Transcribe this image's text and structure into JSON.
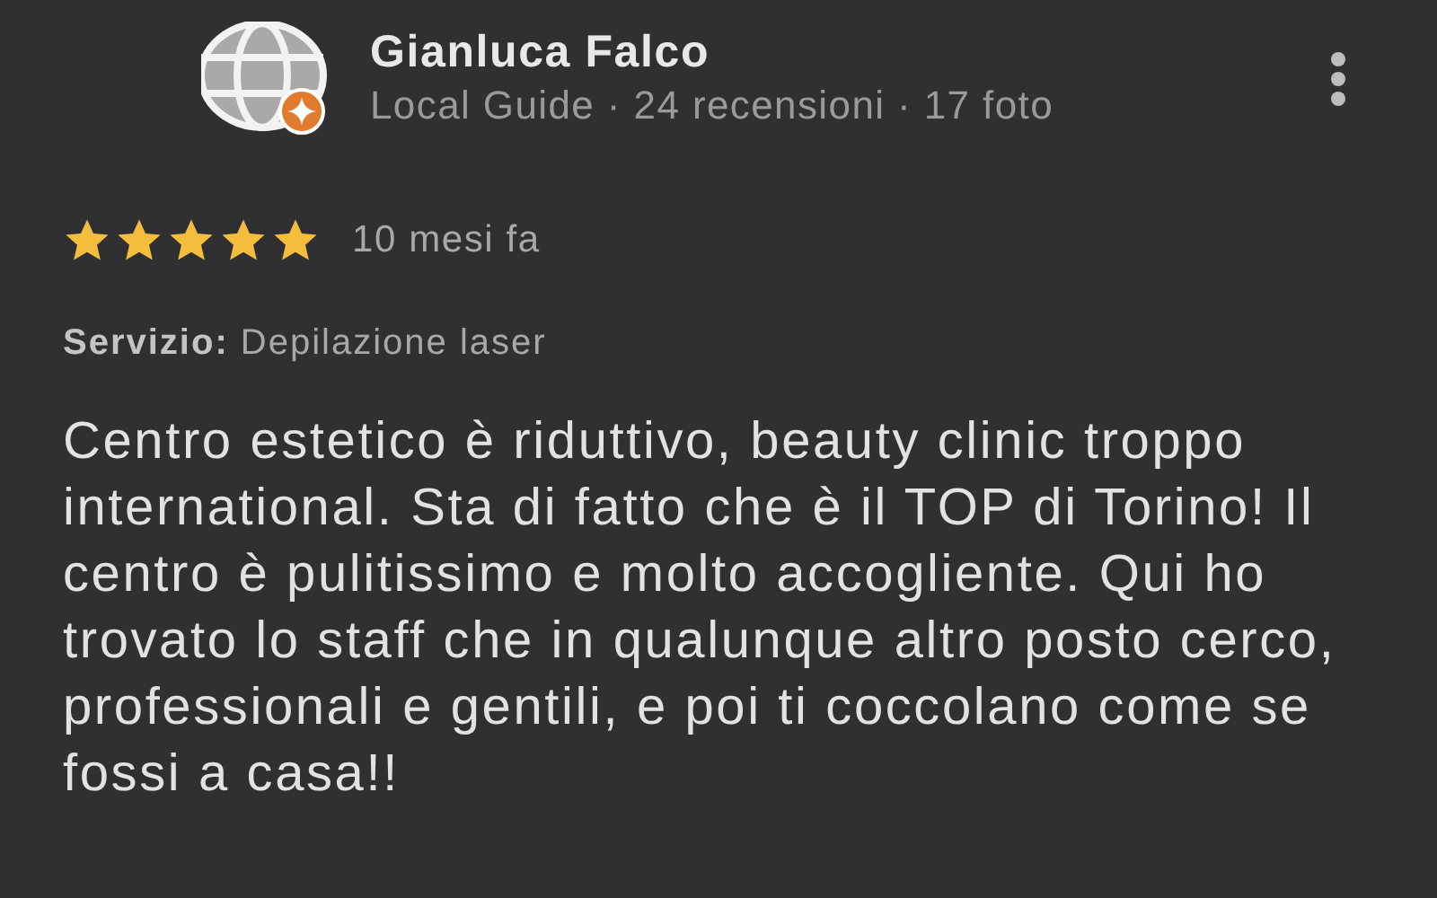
{
  "reviewer": {
    "name": "Gianluca Falco",
    "meta": "Local Guide · 24 recensioni · 17 foto"
  },
  "rating": {
    "stars": 5,
    "time": "10 mesi fa"
  },
  "service": "**Servizio:** Depilazione laser",
  "review_text": "Centro estetico è riduttivo, beauty clinic troppo international. Sta di fatto che è il TOP di Torino! Il centro è pulitissimo e molto accogliente. Qui ho trovato lo staff che in qualunque altro posto cerco, professionali e gentili, e poi ti coccolano come se fossi a casa!!"
}
